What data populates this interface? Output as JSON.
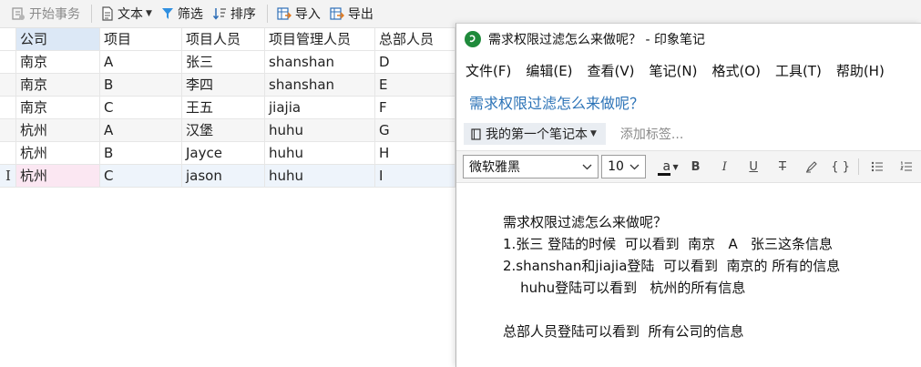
{
  "toolbar": {
    "begin_tx": "开始事务",
    "text": "文本",
    "filter": "筛选",
    "sort": "排序",
    "import": "导入",
    "export": "导出"
  },
  "table": {
    "columns": [
      "公司",
      "项目",
      "项目人员",
      "项目管理人员",
      "总部人员"
    ],
    "rows": [
      [
        "南京",
        "A",
        "张三",
        "shanshan",
        "D"
      ],
      [
        "南京",
        "B",
        "李四",
        "shanshan",
        "E"
      ],
      [
        "南京",
        "C",
        "王五",
        "jiajia",
        "F"
      ],
      [
        "杭州",
        "A",
        "汉堡",
        "huhu",
        "G"
      ],
      [
        "杭州",
        "B",
        "Jayce",
        "huhu",
        "H"
      ],
      [
        "杭州",
        "C",
        "jason",
        "huhu",
        "I"
      ]
    ],
    "cursor_glyph": "I"
  },
  "evernote": {
    "window_title": "需求权限过滤怎么来做呢？ - 印象笔记",
    "menu": [
      "文件(F)",
      "编辑(E)",
      "查看(V)",
      "笔记(N)",
      "格式(O)",
      "工具(T)",
      "帮助(H)"
    ],
    "note_title": "需求权限过滤怎么来做呢？",
    "notebook": "我的第一个笔记本",
    "tags_placeholder": "添加标签...",
    "font": "微软雅黑",
    "size": "10",
    "format_buttons": {
      "color": "a",
      "bold": "B",
      "italic": "I",
      "underline": "U",
      "strike": "T",
      "code": "{ }"
    },
    "body": [
      "需求权限过滤怎么来做呢？",
      "1.张三 登陆的时候  可以看到  南京   A   张三这条信息",
      "2.shanshan和jiajia登陆  可以看到  南京的 所有的信息",
      "    huhu登陆可以看到   杭州的所有信息",
      "",
      "总部人员登陆可以看到  所有公司的信息"
    ]
  },
  "colors": {
    "accent": "#2c73b7",
    "logo": "#1f8a3b",
    "selected_header": "#dce8f6"
  }
}
